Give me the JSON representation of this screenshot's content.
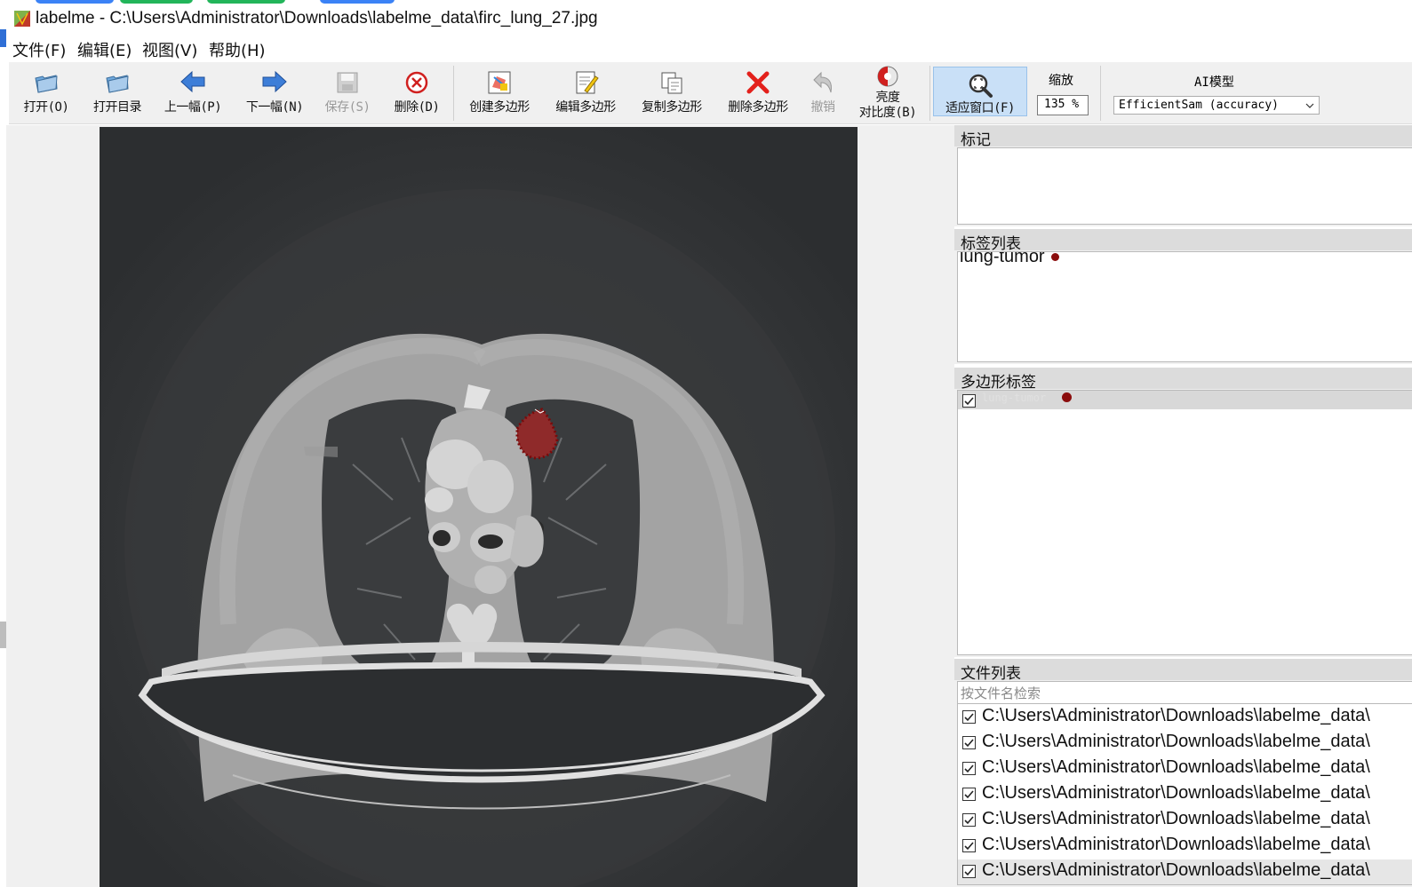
{
  "window": {
    "title": "labelme - C:\\Users\\Administrator\\Downloads\\labelme_data\\firc_lung_27.jpg"
  },
  "menu": [
    {
      "label": "文件(F)"
    },
    {
      "label": "编辑(E)"
    },
    {
      "label": "视图(V)"
    },
    {
      "label": "帮助(H)"
    }
  ],
  "toolbar": {
    "open": "打开(O)",
    "open_dir": "打开目录",
    "prev": "上一幅(P)",
    "next": "下一幅(N)",
    "save": "保存(S)",
    "delete": "删除(D)",
    "create_polygon": "创建多边形",
    "edit_polygon": "编辑多边形",
    "copy_polygon": "复制多边形",
    "delete_polygon": "删除多边形",
    "undo": "撤销",
    "brightness_line1": "亮度",
    "brightness_line2": "对比度(B)",
    "fit_window": "适应窗口(F)",
    "zoom_label": "缩放",
    "zoom_value": "135 %",
    "ai_label": "AI模型",
    "ai_model": "EfficientSam (accuracy)"
  },
  "docks": {
    "flags": {
      "title": "标记"
    },
    "labels": {
      "title": "标签列表",
      "items": [
        {
          "text": "lung-tumor",
          "color": "#8b0d0d"
        }
      ]
    },
    "polygons": {
      "title": "多边形标签",
      "items": [
        {
          "text": "lung-tumor",
          "checked": true,
          "color": "#8b0d0d"
        }
      ]
    },
    "files": {
      "title": "文件列表",
      "search_placeholder": "按文件名检索",
      "items": [
        "C:\\Users\\Administrator\\Downloads\\labelme_data\\",
        "C:\\Users\\Administrator\\Downloads\\labelme_data\\",
        "C:\\Users\\Administrator\\Downloads\\labelme_data\\",
        "C:\\Users\\Administrator\\Downloads\\labelme_data\\",
        "C:\\Users\\Administrator\\Downloads\\labelme_data\\",
        "C:\\Users\\Administrator\\Downloads\\labelme_data\\",
        "C:\\Users\\Administrator\\Downloads\\labelme_data\\"
      ]
    }
  },
  "colors": {
    "accent": "#c9e0f7",
    "label": "#8b0d0d"
  },
  "icons": [
    "app-icon",
    "open-folder-icon",
    "open-dir-icon",
    "prev-arrow-icon",
    "next-arrow-icon",
    "save-icon",
    "delete-circle-icon",
    "create-polygon-icon",
    "edit-polygon-icon",
    "copy-polygon-icon",
    "delete-x-icon",
    "undo-icon",
    "brightness-icon",
    "zoom-fit-icon",
    "checkbox-icon"
  ]
}
